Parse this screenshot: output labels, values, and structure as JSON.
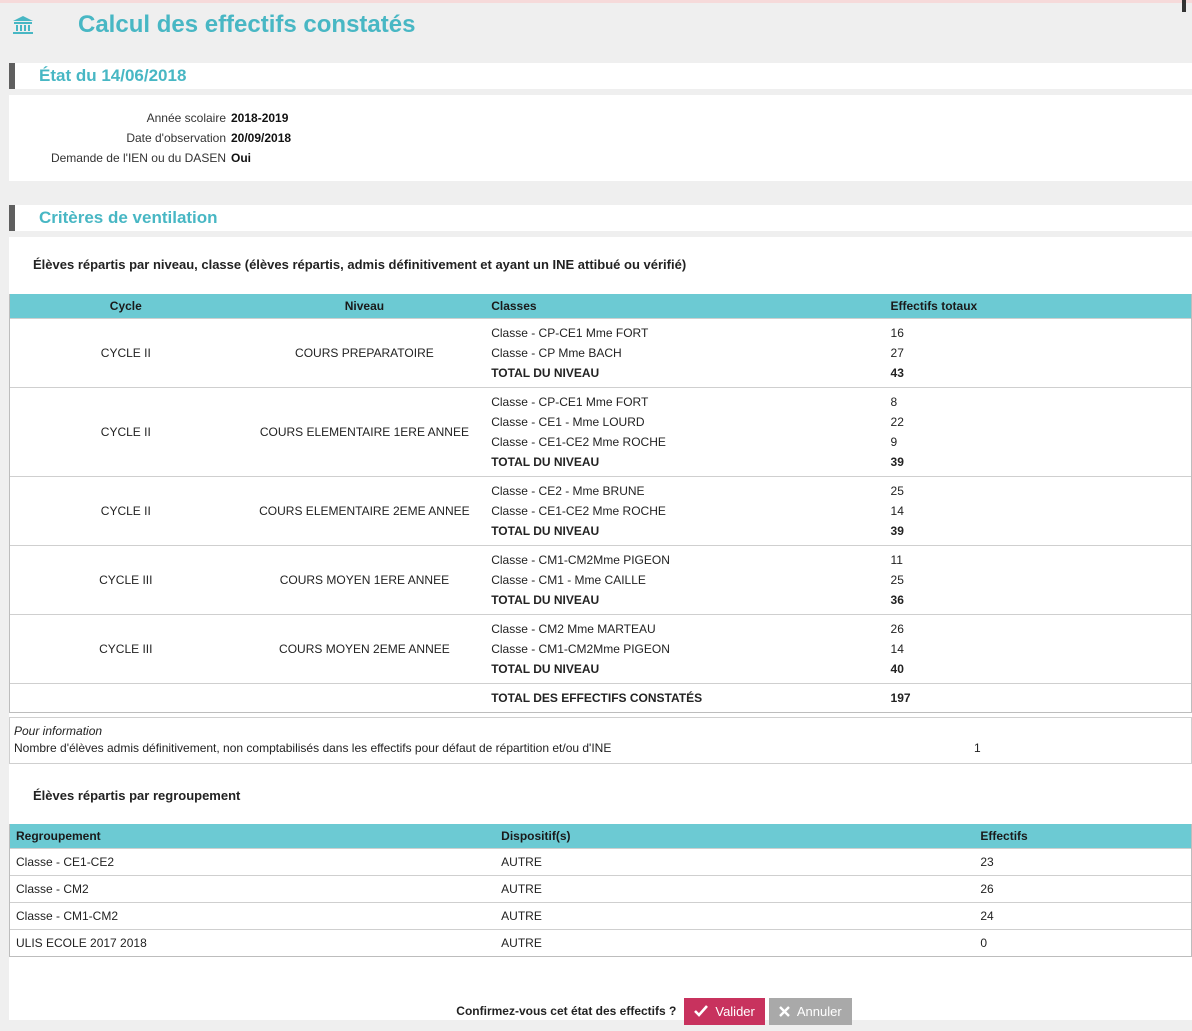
{
  "page": {
    "title": "Calcul des effectifs constatés"
  },
  "etat": {
    "heading": "État du 14/06/2018",
    "rows": [
      {
        "label": "Année scolaire",
        "value": "2018-2019"
      },
      {
        "label": "Date d'observation",
        "value": "20/09/2018"
      },
      {
        "label": "Demande de l'IEN ou du DASEN",
        "value": "Oui"
      }
    ]
  },
  "criteres": {
    "heading": "Critères de ventilation",
    "subheading_niveau": "Élèves répartis par niveau, classe (élèves répartis, admis définitivement et ayant un INE attibué ou vérifié)",
    "columns": [
      "Cycle",
      "Niveau",
      "Classes",
      "Effectifs totaux"
    ],
    "groups": [
      {
        "cycle": "CYCLE II",
        "niveau": "COURS PREPARATOIRE",
        "lines": [
          {
            "classe": "Classe - CP-CE1 Mme FORT",
            "effectif": "16"
          },
          {
            "classe": "Classe - CP Mme BACH",
            "effectif": "27"
          },
          {
            "classe": "TOTAL DU NIVEAU",
            "effectif": "43"
          }
        ]
      },
      {
        "cycle": "CYCLE II",
        "niveau": "COURS ELEMENTAIRE 1ERE ANNEE",
        "lines": [
          {
            "classe": "Classe - CP-CE1 Mme FORT",
            "effectif": "8"
          },
          {
            "classe": "Classe - CE1 - Mme LOURD",
            "effectif": "22"
          },
          {
            "classe": "Classe - CE1-CE2 Mme ROCHE",
            "effectif": "9"
          },
          {
            "classe": "TOTAL DU NIVEAU",
            "effectif": "39"
          }
        ]
      },
      {
        "cycle": "CYCLE II",
        "niveau": "COURS ELEMENTAIRE 2EME ANNEE",
        "lines": [
          {
            "classe": "Classe - CE2 - Mme BRUNE",
            "effectif": "25"
          },
          {
            "classe": "Classe - CE1-CE2 Mme ROCHE",
            "effectif": "14"
          },
          {
            "classe": "TOTAL DU NIVEAU",
            "effectif": "39"
          }
        ]
      },
      {
        "cycle": "CYCLE III",
        "niveau": "COURS MOYEN 1ERE ANNEE",
        "lines": [
          {
            "classe": "Classe - CM1-CM2Mme PIGEON",
            "effectif": "11"
          },
          {
            "classe": "Classe - CM1 - Mme CAILLE",
            "effectif": "25"
          },
          {
            "classe": "TOTAL DU NIVEAU",
            "effectif": "36"
          }
        ]
      },
      {
        "cycle": "CYCLE III",
        "niveau": "COURS MOYEN 2EME ANNEE",
        "lines": [
          {
            "classe": "Classe - CM2 Mme MARTEAU",
            "effectif": "26"
          },
          {
            "classe": "Classe - CM1-CM2Mme PIGEON",
            "effectif": "14"
          },
          {
            "classe": "TOTAL DU NIVEAU",
            "effectif": "40"
          }
        ]
      }
    ],
    "grand_total": {
      "label": "TOTAL DES EFFECTIFS CONSTATÉS",
      "value": "197"
    },
    "pour_information": {
      "title": "Pour information",
      "text": "Nombre d'élèves admis définitivement, non comptabilisés dans les effectifs pour défaut de répartition et/ou d'INE",
      "value": "1"
    },
    "subheading_regroupement": "Élèves répartis par regroupement",
    "regroupement_columns": [
      "Regroupement",
      "Dispositif(s)",
      "Effectifs"
    ],
    "regroupements": [
      {
        "regroupement": "Classe - CE1-CE2",
        "dispositif": "AUTRE",
        "effectif": "23"
      },
      {
        "regroupement": "Classe - CM2",
        "dispositif": "AUTRE",
        "effectif": "26"
      },
      {
        "regroupement": "Classe - CM1-CM2",
        "dispositif": "AUTRE",
        "effectif": "24"
      },
      {
        "regroupement": "ULIS ECOLE 2017 2018",
        "dispositif": "AUTRE",
        "effectif": "0"
      }
    ]
  },
  "footer": {
    "question": "Confirmez-vous cet état des effectifs ?",
    "valider_label": "Valider",
    "annuler_label": "Annuler"
  },
  "colors": {
    "accent_title": "#48b7c4",
    "table_header": "#6ccad3",
    "valider": "#c8325e",
    "annuler": "#a9a9a9"
  },
  "icons": {
    "page": "bank-icon",
    "valider": "check-icon",
    "annuler": "close-icon"
  }
}
